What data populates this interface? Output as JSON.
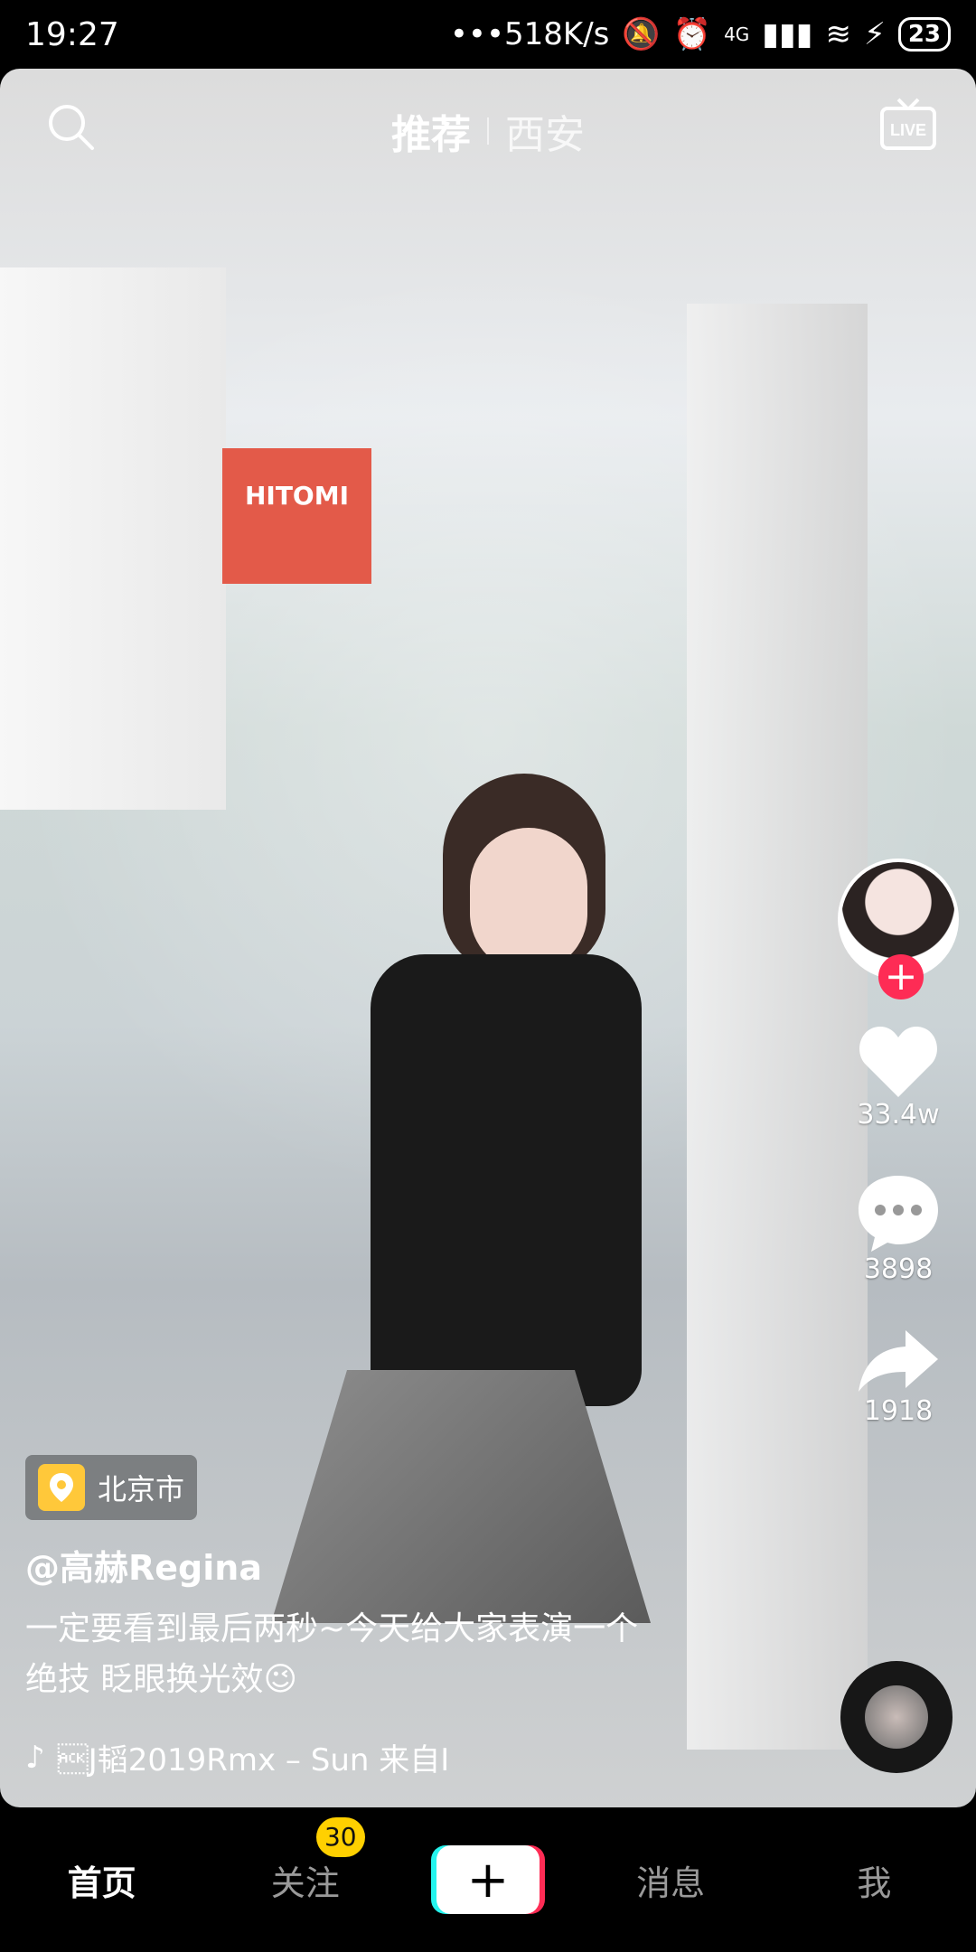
{
  "status_bar": {
    "time": "19:27",
    "net_speed": "•••518K/s",
    "network": "4G",
    "battery": "23"
  },
  "top_nav": {
    "tabs": [
      "推荐",
      "西安"
    ],
    "active_index": 0
  },
  "video_scene": {
    "shop_sign": "HITOMI"
  },
  "sidebar": {
    "likes": "33.4w",
    "comments": "3898",
    "shares": "1918"
  },
  "post": {
    "location": "北京市",
    "username": "@高赫Regina",
    "caption_line1": "一定要看到最后两秒~今天给大家表演一个",
    "caption_line2": "绝技 眨眼换光效😉",
    "music": "\u0006J韬2019Rmx – Sun    来自I"
  },
  "bottom_nav": {
    "items": [
      "首页",
      "关注",
      "消息",
      "我"
    ],
    "follow_badge": "30",
    "active": "首页"
  },
  "colors": {
    "accent": "#fe2c55",
    "badge": "#ffd000",
    "teal": "#25f4ee"
  }
}
